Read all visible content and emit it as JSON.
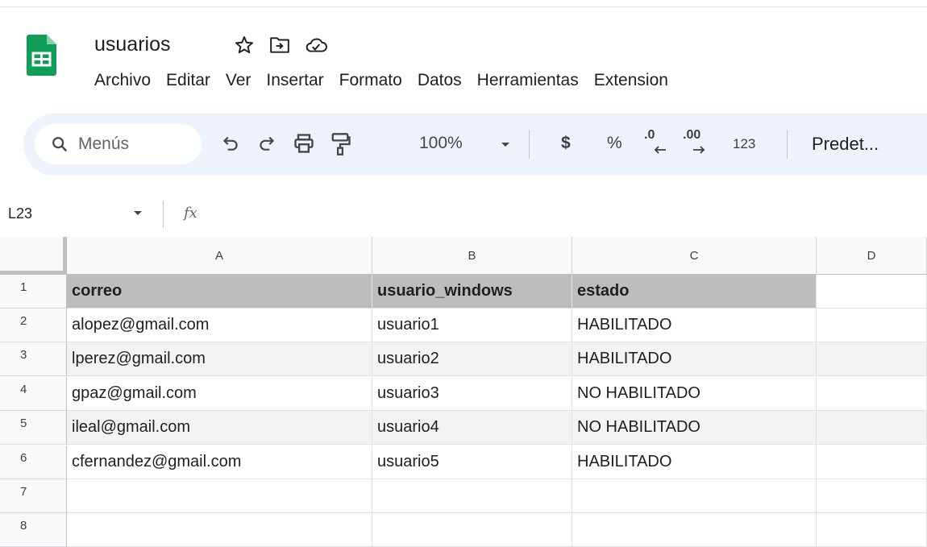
{
  "document": {
    "title": "usuarios"
  },
  "menu": [
    "Archivo",
    "Editar",
    "Ver",
    "Insertar",
    "Formato",
    "Datos",
    "Herramientas",
    "Extension"
  ],
  "toolbar": {
    "search_placeholder": "Menús",
    "zoom": "100%",
    "currency": "$",
    "percent": "%",
    "decrease_decimals": ".0",
    "increase_decimals": ".00",
    "number_format": "123",
    "font_default": "Predet..."
  },
  "formula_bar": {
    "cell_ref": "L23",
    "fx": "fx",
    "content": ""
  },
  "sheet": {
    "columns": [
      "A",
      "B",
      "C",
      "D"
    ],
    "row_numbers": [
      "1",
      "2",
      "3",
      "4",
      "5",
      "6",
      "7",
      "8"
    ],
    "rows": [
      [
        "correo",
        "usuario_windows",
        "estado",
        ""
      ],
      [
        "alopez@gmail.com",
        "usuario1",
        "HABILITADO",
        ""
      ],
      [
        "lperez@gmail.com",
        "usuario2",
        "HABILITADO",
        ""
      ],
      [
        "gpaz@gmail.com",
        "usuario3",
        "NO HABILITADO",
        ""
      ],
      [
        "ileal@gmail.com",
        "usuario4",
        "NO HABILITADO",
        ""
      ],
      [
        "cfernandez@gmail.com",
        "usuario5",
        "HABILITADO",
        ""
      ],
      [
        "",
        "",
        "",
        ""
      ],
      [
        "",
        "",
        "",
        ""
      ]
    ]
  },
  "colors": {
    "sheets_green": "#0f9d58",
    "toolbar_bg": "#eef2f9",
    "header_fill": "#bdbdbd",
    "stripe_fill": "#f3f3f3"
  }
}
